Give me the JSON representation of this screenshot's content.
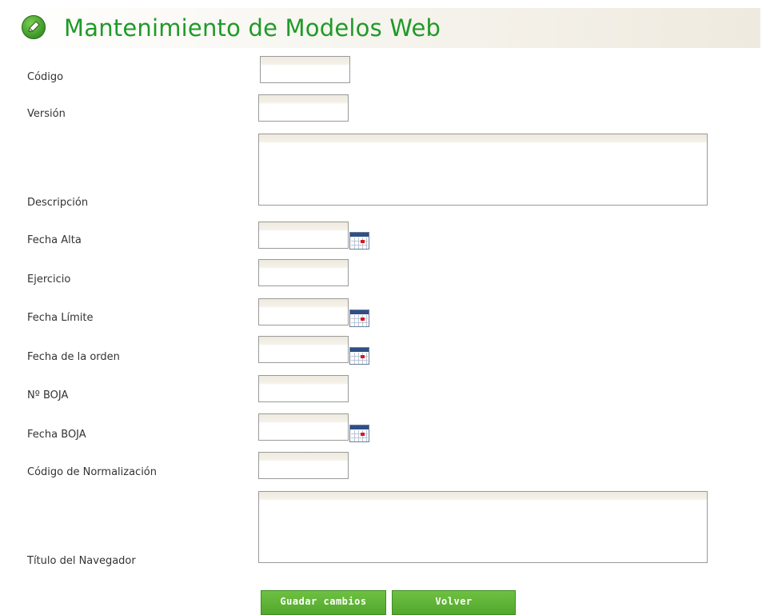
{
  "header": {
    "title": "Mantenimiento de Modelos Web",
    "logo_icon": "edit-pencil-icon"
  },
  "form": {
    "codigo": {
      "label": "Código",
      "value": ""
    },
    "version": {
      "label": "Versión",
      "value": ""
    },
    "descripcion": {
      "label": "Descripción",
      "value": ""
    },
    "fecha_alta": {
      "label": "Fecha Alta",
      "value": ""
    },
    "ejercicio": {
      "label": "Ejercicio",
      "value": ""
    },
    "fecha_limite": {
      "label": "Fecha Límite",
      "value": ""
    },
    "fecha_orden": {
      "label": "Fecha de la orden",
      "value": ""
    },
    "num_boja": {
      "label": "Nº BOJA",
      "value": ""
    },
    "fecha_boja": {
      "label": "Fecha BOJA",
      "value": ""
    },
    "codigo_normalizacion": {
      "label": "Código de Normalización",
      "value": ""
    },
    "titulo_navegador": {
      "label": "Título del Navegador",
      "value": ""
    }
  },
  "actions": {
    "save_label": "Guadar cambios",
    "back_label": "Volver"
  },
  "colors": {
    "accent": "#1f9a28",
    "button": "#5cb232",
    "calendar": "#2f4f86"
  }
}
